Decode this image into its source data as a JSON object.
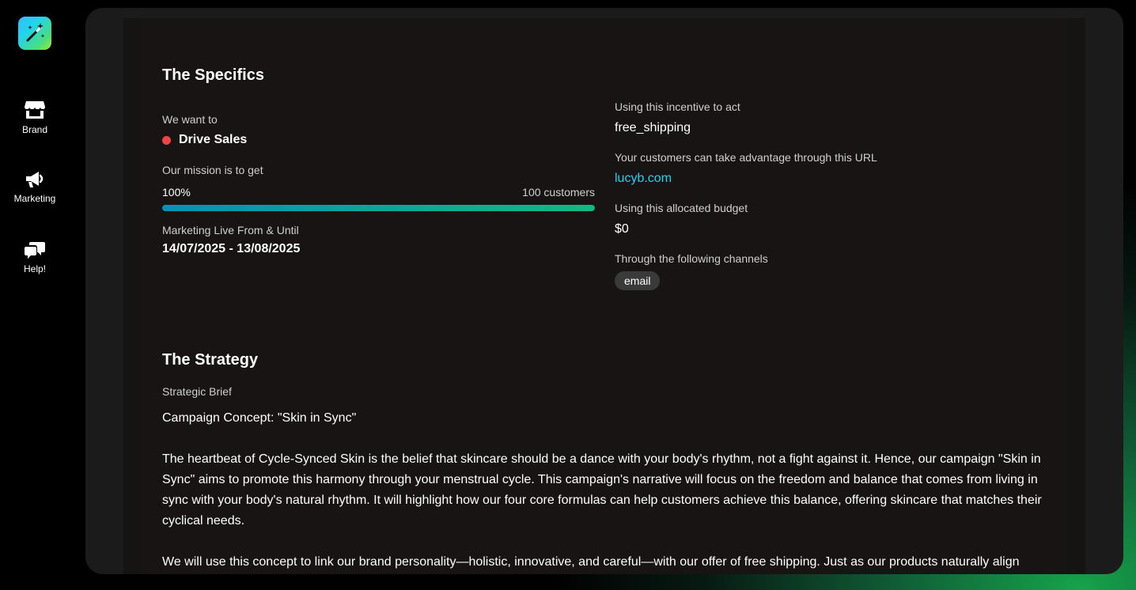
{
  "sidebar": {
    "items": [
      {
        "label": "Brand",
        "icon": "store-icon"
      },
      {
        "label": "Marketing",
        "icon": "megaphone-icon"
      },
      {
        "label": "Help!",
        "icon": "chat-bubbles-icon"
      }
    ]
  },
  "specifics": {
    "title": "The Specifics",
    "goal_label": "We want to",
    "goal_value": "Drive Sales",
    "mission_label": "Our mission is to get",
    "progress_percent": "100%",
    "progress_target": "100 customers",
    "progress_fraction": 1.0,
    "dates_label": "Marketing Live From & Until",
    "dates_value": "14/07/2025 - 13/08/2025",
    "incentive_label": "Using this incentive to act",
    "incentive_value": "free_shipping",
    "url_label": "Your customers can take advantage through this URL",
    "url_value": "lucyb.com",
    "budget_label": "Using this allocated budget",
    "budget_value": "$0",
    "channels_label": "Through the following channels",
    "channels": [
      "email"
    ]
  },
  "strategy": {
    "title": "The Strategy",
    "brief_label": "Strategic Brief",
    "paragraphs": [
      "Campaign Concept: \"Skin in Sync\"",
      "The heartbeat of Cycle-Synced Skin is the belief that skincare should be a dance with your body's rhythm, not a fight against it. Hence, our campaign \"Skin in Sync\" aims to promote this harmony through your menstrual cycle. This campaign's narrative will focus on the freedom and balance that comes from living in sync with your body's natural rhythm. It will highlight how our four core formulas can help customers achieve this balance, offering skincare that matches their cyclical needs.",
      "We will use this concept to link our brand personality—holistic, innovative, and careful—with our offer of free shipping. Just as our products naturally align with customers' cycles, we want the purchasing journey to feel seamless and convenient."
    ]
  },
  "colors": {
    "accent_gradient_start": "#0891b2",
    "accent_gradient_end": "#10b981",
    "goal_dot": "#ef4444",
    "link": "#22d3ee"
  }
}
